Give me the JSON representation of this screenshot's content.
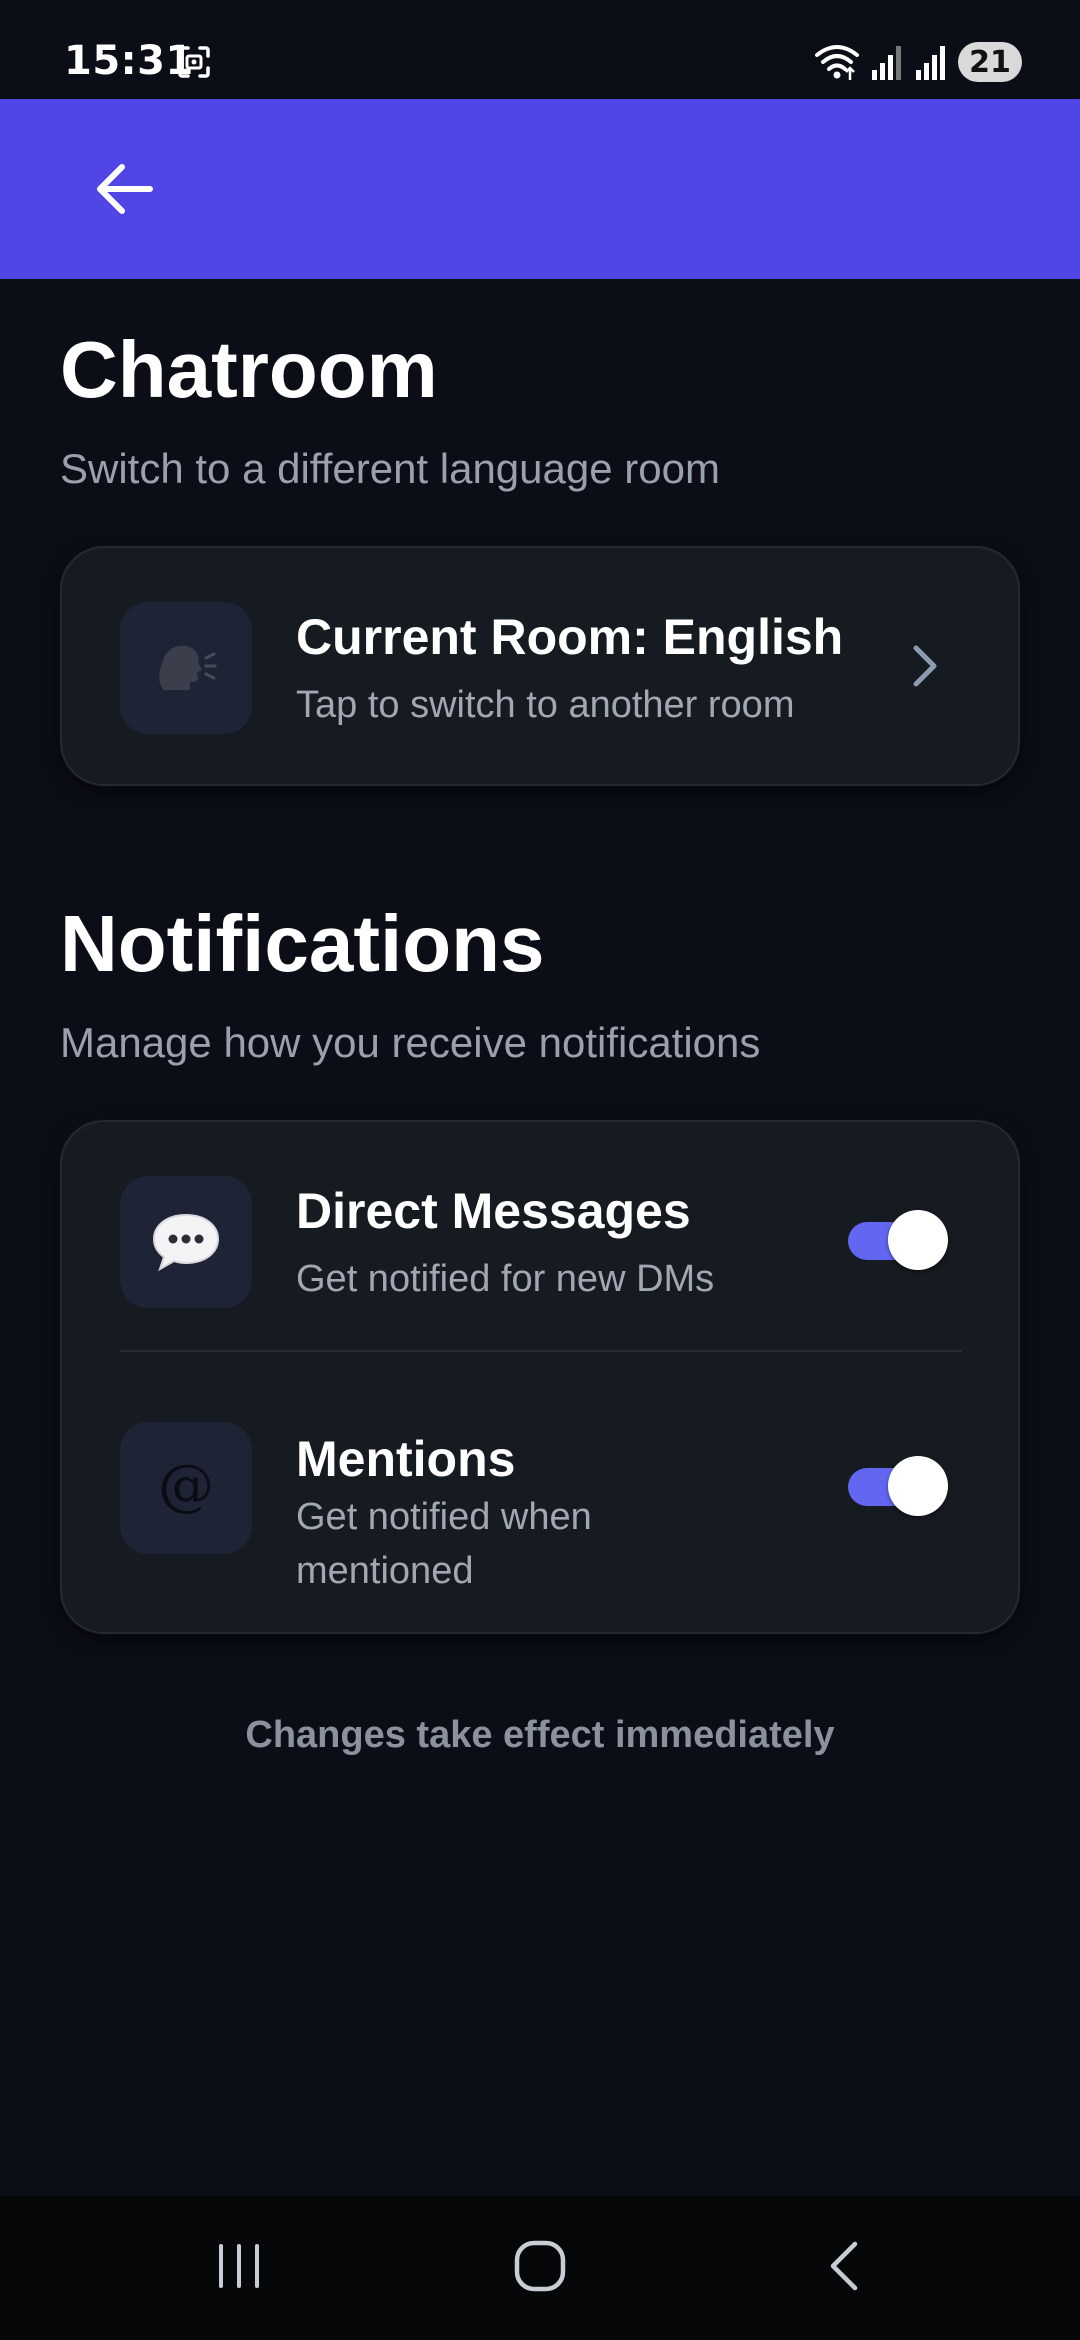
{
  "status_bar": {
    "time": "15:31",
    "battery": "21"
  },
  "app_bar": {
    "back_icon": "arrow-left-icon"
  },
  "chatroom": {
    "title": "Chatroom",
    "subtitle": "Switch to a different language room",
    "room_card": {
      "icon": "speaking-head-icon",
      "title": "Current Room: English",
      "subtitle": "Tap to switch to another room",
      "chevron": "chevron-right-icon"
    }
  },
  "notifications": {
    "title": "Notifications",
    "subtitle": "Manage how you receive notifications",
    "items": [
      {
        "icon": "speech-bubble-icon",
        "title": "Direct Messages",
        "subtitle": "Get notified for new DMs",
        "enabled": true
      },
      {
        "icon": "at-sign-icon",
        "title": "Mentions",
        "subtitle": "Get notified when mentioned",
        "enabled": true
      }
    ]
  },
  "footer_note": "Changes take effect immediately",
  "colors": {
    "accent": "#4f46e5",
    "toggle_on": "#6366f1",
    "background": "#0b0e16",
    "card": "#161a21"
  }
}
